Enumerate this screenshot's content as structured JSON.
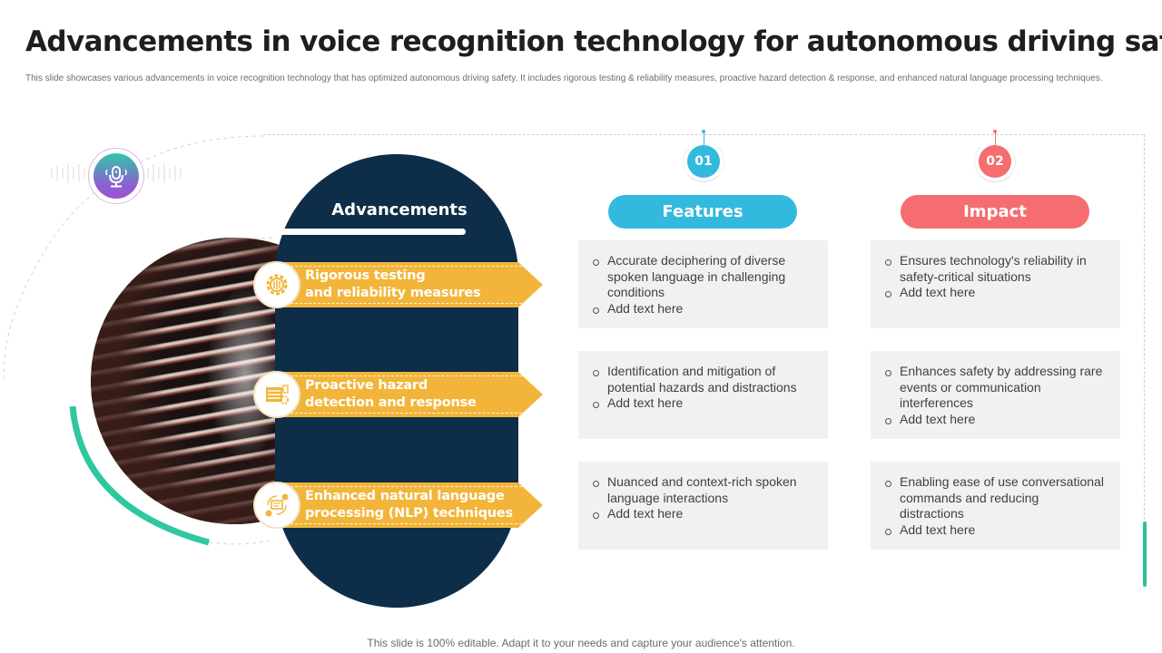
{
  "header": {
    "title": "Advancements in voice recognition technology for autonomous driving safety",
    "subtitle": "This slide showcases various advancements in voice recognition technology that has optimized autonomous  driving safety. It includes rigorous testing & reliability measures, proactive hazard detection & response, and enhanced natural language processing techniques."
  },
  "advancements": {
    "title": "Advancements",
    "items": [
      {
        "label": "Rigorous testing\nand reliability measures",
        "line1": "Rigorous testing",
        "line2": "and reliability measures",
        "icon": "gear-testing-icon"
      },
      {
        "label": "Proactive hazard\ndetection and response",
        "line1": "Proactive hazard",
        "line2": "detection  and response",
        "icon": "hazard-detection-icon"
      },
      {
        "label": "Enhanced natural language\nprocessing (NLP) techniques",
        "line1": "Enhanced natural language",
        "line2": "processing  (NLP) techniques",
        "icon": "nlp-chat-icon"
      }
    ]
  },
  "columns": [
    {
      "number": "01",
      "header": "Features",
      "color": "#33b9dd",
      "cards": [
        [
          "Accurate deciphering of diverse spoken language in challenging conditions",
          "Add text here"
        ],
        [
          "Identification and mitigation of potential hazards and distractions",
          "Add text here"
        ],
        [
          "Nuanced and context-rich spoken language interactions",
          "Add text here"
        ]
      ]
    },
    {
      "number": "02",
      "header": "Impact",
      "color": "#f56d70",
      "cards": [
        [
          "Ensures technology's reliability in safety-critical situations",
          "Add text here"
        ],
        [
          "Enhances safety by addressing rare events or communication interferences",
          "Add text here"
        ],
        [
          "Enabling ease of use conversational commands and reducing distractions",
          "Add text here"
        ]
      ]
    }
  ],
  "colors": {
    "navy": "#0e2d48",
    "ribbon_yellow": "#f2b53a",
    "accent_green": "#2fbf9a",
    "features_blue": "#33b9dd",
    "impact_red": "#f56d70",
    "card_bg": "#f1f1f1"
  },
  "icons": {
    "top_badge": "microphone-icon",
    "photo": "vintage-microphone-photo"
  },
  "footer": {
    "text": "This slide is 100% editable. Adapt it to your needs and capture your audience's attention."
  }
}
